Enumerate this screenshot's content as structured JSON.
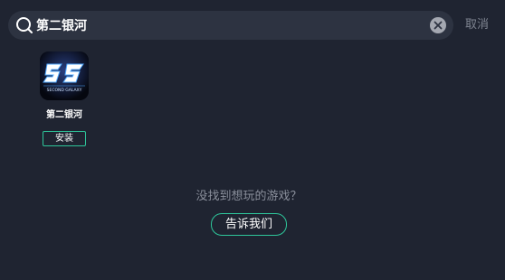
{
  "search": {
    "value": "第二银河",
    "cancel_label": "取消"
  },
  "results": [
    {
      "name": "第二银河",
      "icon": "second-galaxy-logo-icon",
      "logo_text": "SECOND GALAXY",
      "install_label": "安装"
    }
  ],
  "empty": {
    "hint": "没找到想玩的游戏？",
    "tell_us_label": "告诉我们"
  },
  "colors": {
    "background": "#1f2431",
    "search_bg": "#2d3341",
    "accent": "#2ec79b",
    "muted_text": "#8a8f9b"
  }
}
